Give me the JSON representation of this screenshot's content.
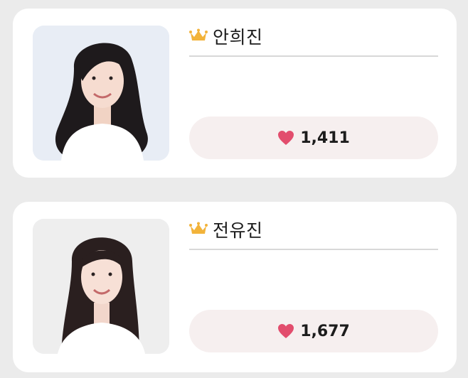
{
  "accent_colors": {
    "crown": "#f2b33a",
    "heart": "#e24d6d",
    "vote_button_bg": "#f6efef"
  },
  "cards": [
    {
      "name": "안희진",
      "votes": "1,411",
      "crown_icon": "crown-icon",
      "heart_icon": "heart-icon"
    },
    {
      "name": "전유진",
      "votes": "1,677",
      "crown_icon": "crown-icon",
      "heart_icon": "heart-icon"
    }
  ]
}
